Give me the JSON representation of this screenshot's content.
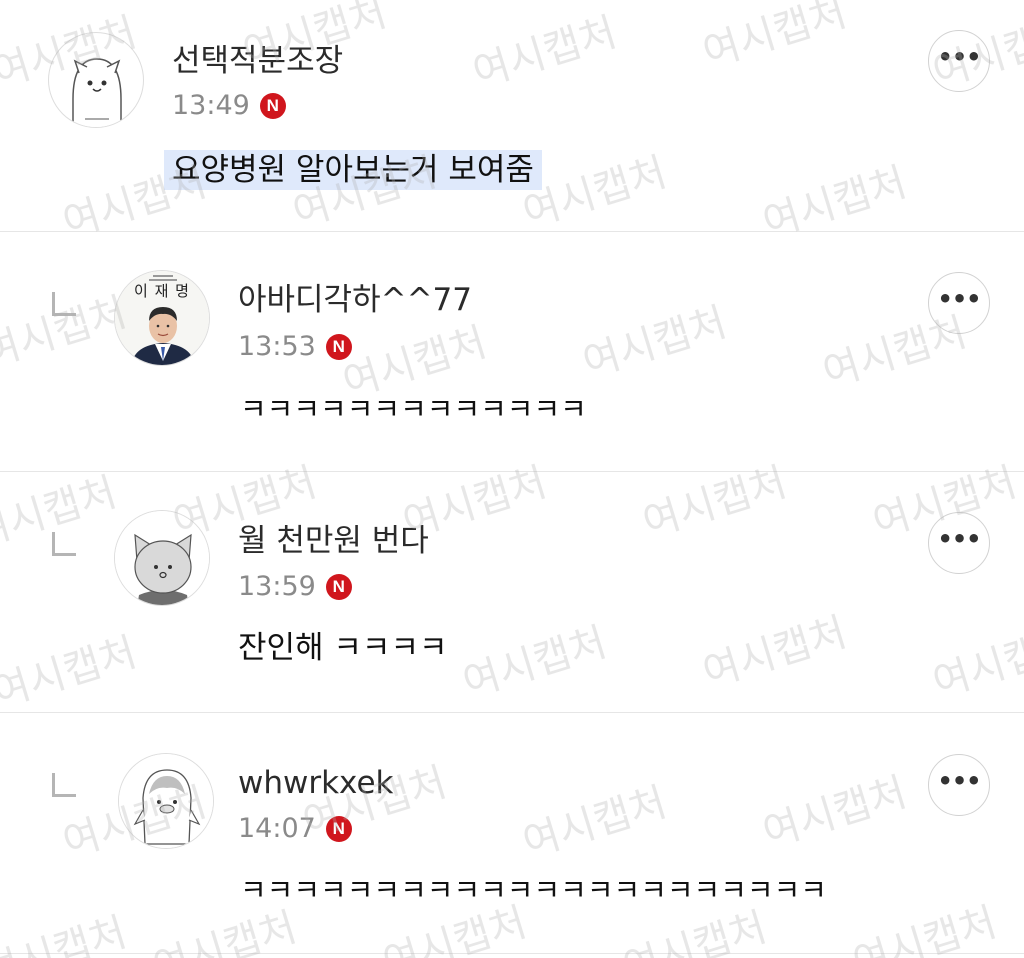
{
  "watermark_text": "여시캡처",
  "more_label": "•••",
  "badge_label": "N",
  "colors": {
    "badge": "#d0161d",
    "highlight": "#dfe9fb",
    "divider": "#e6e6e6",
    "time": "#8a8a8a"
  },
  "comments": [
    {
      "nickname": "선택적분조장",
      "time": "13:49",
      "text": "요양병원 알아보는거 보여줌",
      "is_reply": false,
      "avatar_icon": "white-cat-avatar-icon",
      "highlighted": true
    },
    {
      "nickname": "아바디각하^^77",
      "time": "13:53",
      "text": "ㅋㅋㅋㅋㅋㅋㅋㅋㅋㅋㅋㅋㅋ",
      "is_reply": true,
      "avatar_icon": "candidate-portrait-avatar-icon",
      "avatar_caption": "이 재 명"
    },
    {
      "nickname": "월 천만원 번다",
      "time": "13:59",
      "text": "잔인해 ㅋㅋㅋㅋ",
      "is_reply": true,
      "avatar_icon": "gray-cat-avatar-icon"
    },
    {
      "nickname": "whwrkxek",
      "time": "14:07",
      "text": "ㅋㅋㅋㅋㅋㅋㅋㅋㅋㅋㅋㅋㅋㅋㅋㅋㅋㅋㅋㅋㅋㅋ",
      "is_reply": true,
      "avatar_icon": "penguin-avatar-icon"
    }
  ]
}
